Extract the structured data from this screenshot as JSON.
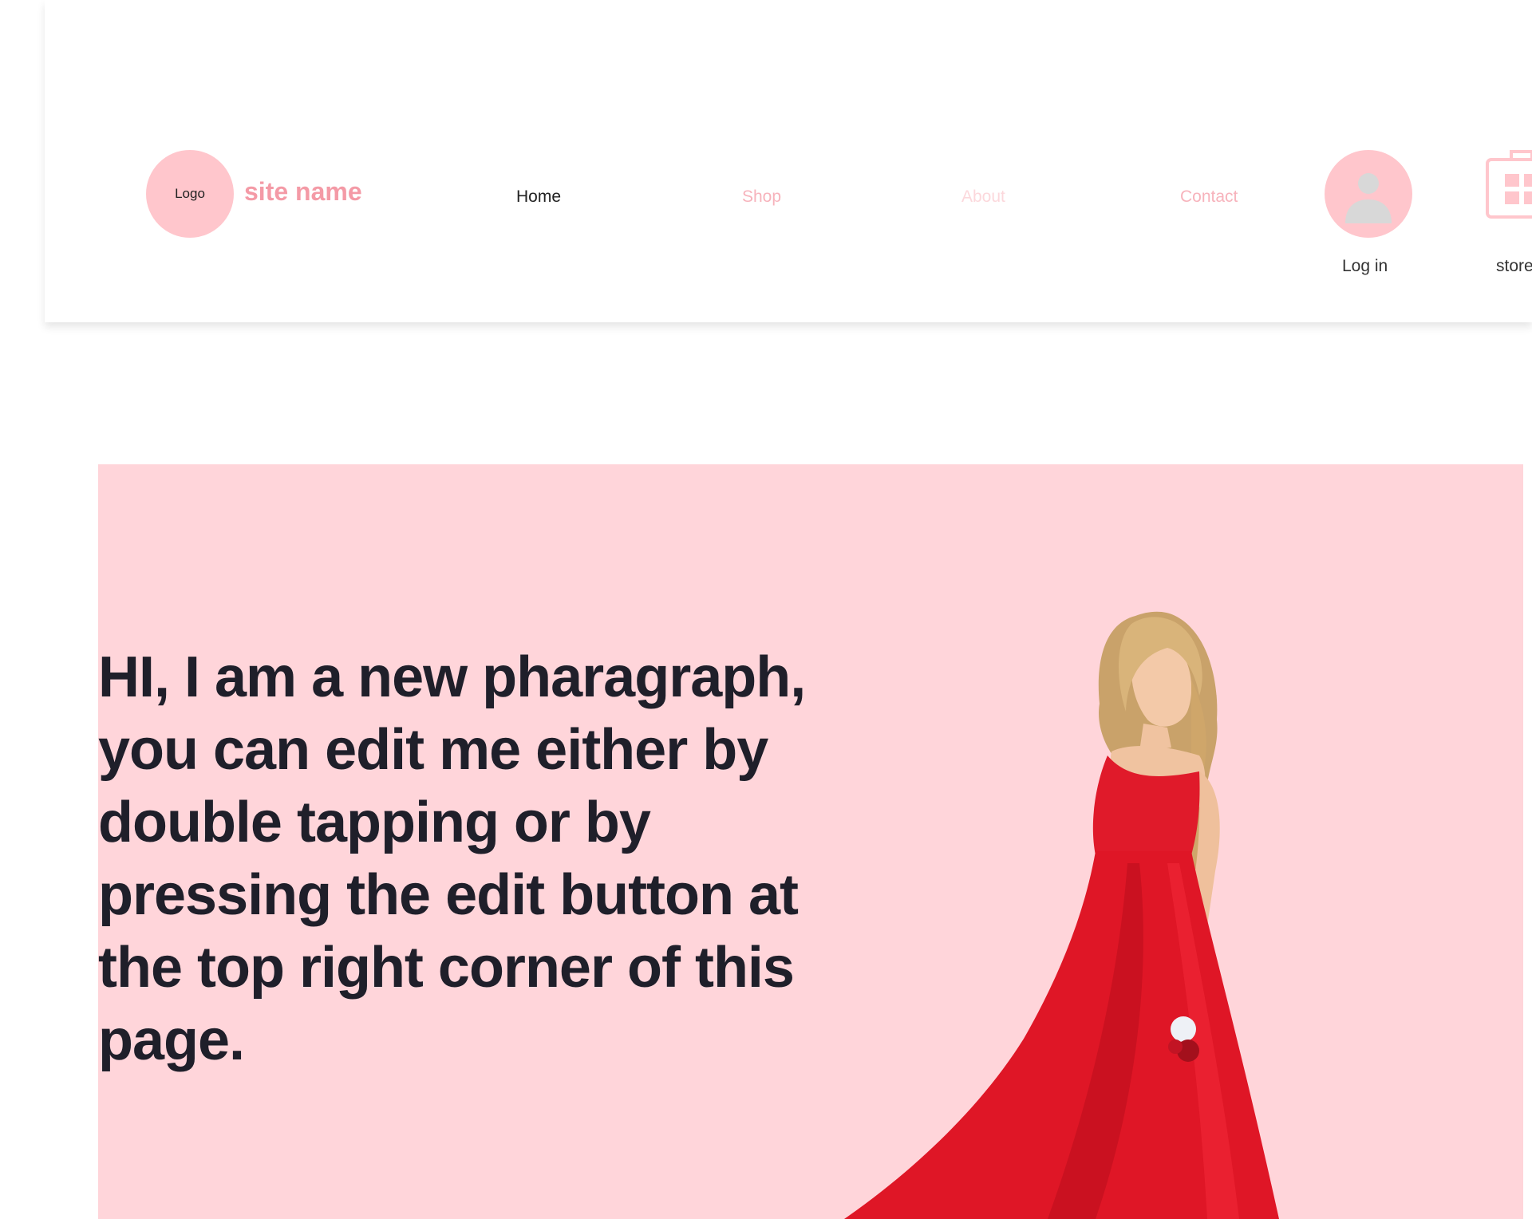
{
  "header": {
    "logo_text": "Logo",
    "site_name": "site name",
    "nav": [
      {
        "label": "Home"
      },
      {
        "label": "Shop"
      },
      {
        "label": "About"
      },
      {
        "label": "Contact"
      }
    ],
    "login_label": "Log in",
    "store_label": "store"
  },
  "hero": {
    "paragraph": "HI, I am a new pharagraph, you can edit me either by double tapping or by pressing the edit button at the top right corner of this page."
  },
  "colors": {
    "accent_pink": "#ffc6cc",
    "hero_background": "#ffd5da",
    "site_name": "#f49aa6",
    "dress_red": "#e01a2a",
    "text_dark": "#1f1f2a"
  },
  "icons": {
    "user": "user-avatar-icon",
    "store": "shopping-bag-icon"
  }
}
